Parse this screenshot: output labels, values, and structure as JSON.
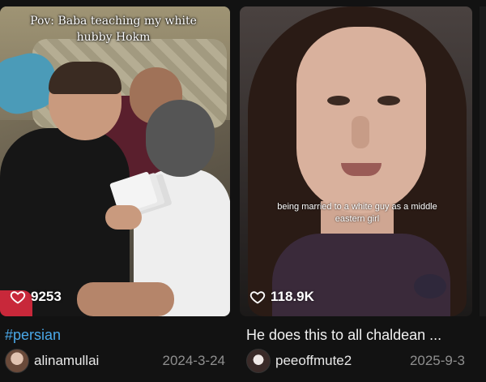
{
  "videos": [
    {
      "overlay_text": "Pov: Baba teaching my white hubby Hokm",
      "views": "9253",
      "title": "#persian",
      "username": "alinamullai",
      "date": "2024-3-24"
    },
    {
      "overlay_text": "being married to a white guy as a middle eastern girl",
      "views": "118.9K",
      "title": "He does this to all chaldean ...",
      "username": "peeoffmute2",
      "date": "2025-9-3"
    }
  ],
  "icons": {
    "views_icon": "heart-outline-icon"
  },
  "colors": {
    "hashtag_title": "#4aa8e8",
    "background": "#121212",
    "date": "#8f8f8f"
  }
}
